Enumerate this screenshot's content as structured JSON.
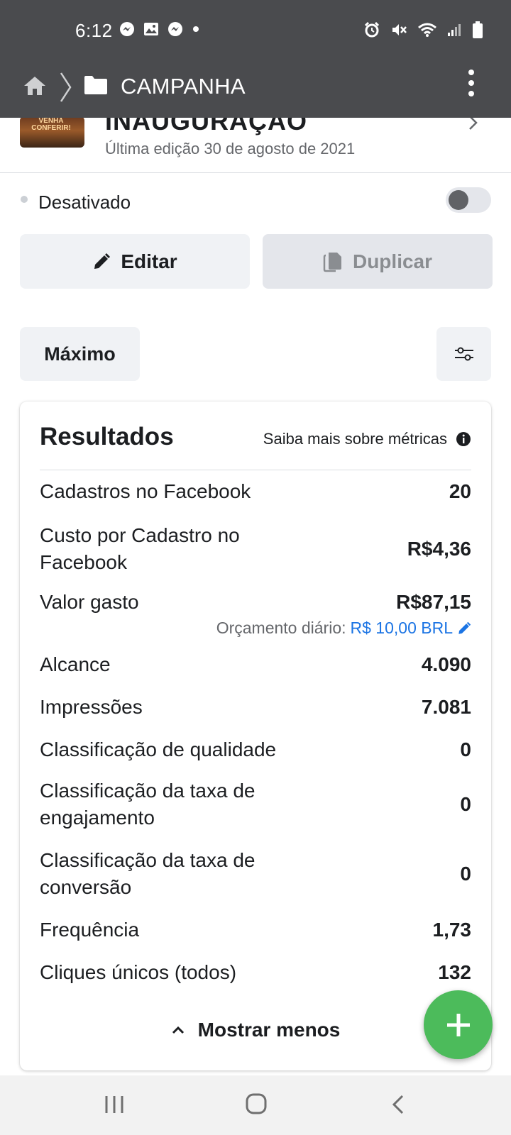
{
  "status_bar": {
    "time": "6:12",
    "left_icons": [
      "messenger-icon",
      "gallery-icon",
      "messenger-icon",
      "dot-icon"
    ],
    "right_icons": [
      "alarm-icon",
      "mute-icon",
      "wifi-icon",
      "signal-icon",
      "battery-icon"
    ]
  },
  "header": {
    "breadcrumb_icons": [
      "home-icon",
      "chevron-right-icon",
      "folder-icon"
    ],
    "title": "CAMPANHA",
    "menu_icon": "kebab-icon"
  },
  "campaign": {
    "thumbnail_text": "VENHA CONFERIR!",
    "name": "INAUGURAÇÃO",
    "last_edited": "Última edição 30 de agosto de 2021"
  },
  "status": {
    "label": "Desativado",
    "toggle_on": false
  },
  "actions": {
    "edit_label": "Editar",
    "duplicate_label": "Duplicar"
  },
  "filter": {
    "range_label": "Máximo"
  },
  "results": {
    "title": "Resultados",
    "metrics_link": "Saiba mais sobre métricas",
    "rows": [
      {
        "label": "Cadastros no Facebook",
        "value": "20"
      },
      {
        "label": "Custo por Cadastro no Facebook",
        "value": "R$4,36"
      },
      {
        "label": "Valor gasto",
        "value": "R$87,15"
      },
      {
        "label": "Alcance",
        "value": "4.090"
      },
      {
        "label": "Impressões",
        "value": "7.081"
      },
      {
        "label": "Classificação de qualidade",
        "value": "0"
      },
      {
        "label": "Classificação da taxa de engajamento",
        "value": "0"
      },
      {
        "label": "Classificação da taxa de conversão",
        "value": "0"
      },
      {
        "label": "Frequência",
        "value": "1,73"
      },
      {
        "label": "Cliques únicos (todos)",
        "value": "132"
      }
    ],
    "budget_label": "Orçamento diário:",
    "budget_value": "R$ 10,00 BRL",
    "show_less": "Mostrar menos"
  },
  "colors": {
    "header_bg": "#4a4b4e",
    "fab": "#4cbb5b",
    "link_blue": "#1b74e4"
  }
}
